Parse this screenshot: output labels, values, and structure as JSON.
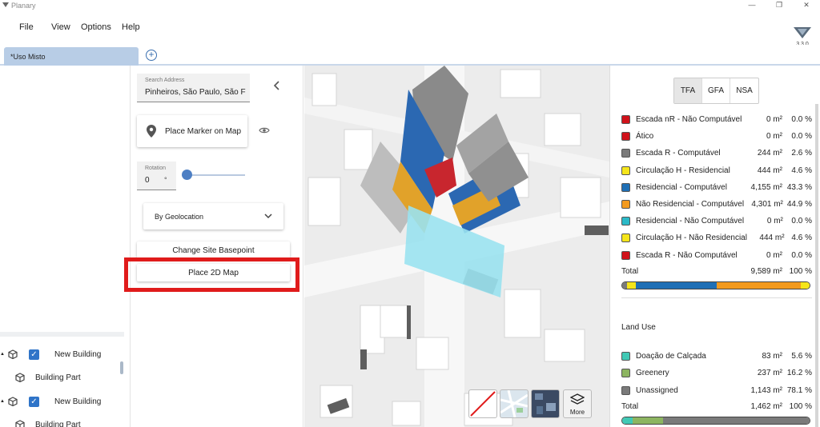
{
  "window": {
    "title": "Planary",
    "minimize": "—",
    "maximize": "❐",
    "close": "✕"
  },
  "menu": [
    "File",
    "View",
    "Options",
    "Help"
  ],
  "version": "3.3.0",
  "tabs": [
    {
      "label": "*Uso Misto"
    }
  ],
  "tree": [
    {
      "label": "New Building"
    },
    {
      "label": "Building Part"
    },
    {
      "label": "New Building"
    },
    {
      "label": "Building Part"
    }
  ],
  "site": {
    "search_label": "Search Address",
    "search_value": "Pinheiros, São Paulo, São F",
    "place_marker": "Place Marker on Map",
    "rotation_label": "Rotation",
    "rotation_value": "0",
    "rotation_unit": "°",
    "geolocation": "By Geolocation",
    "change_basepoint": "Change Site Basepoint",
    "place_2d_map": "Place 2D Map"
  },
  "map_controls": {
    "more": "More"
  },
  "area_tabs": {
    "items": [
      "TFA",
      "GFA",
      "NSA"
    ],
    "active": "TFA"
  },
  "area_rows": [
    {
      "label": "Escada nR - Não Computável",
      "area": "0 m²",
      "pct": "0.0 %",
      "color": "#d0121b"
    },
    {
      "label": "Ático",
      "area": "0 m²",
      "pct": "0.0 %",
      "color": "#d0121b"
    },
    {
      "label": "Escada R - Computável",
      "area": "244 m²",
      "pct": "2.6 %",
      "color": "#7a7a7a"
    },
    {
      "label": "Circulação H - Residencial",
      "area": "444 m²",
      "pct": "4.6 %",
      "color": "#f5e51a"
    },
    {
      "label": "Residencial - Computável",
      "area": "4,155 m²",
      "pct": "43.3 %",
      "color": "#1f6fb5"
    },
    {
      "label": "Não Residencial - Computável",
      "area": "4,301 m²",
      "pct": "44.9 %",
      "color": "#f39a1e"
    },
    {
      "label": "Residencial - Não Computável",
      "area": "0 m²",
      "pct": "0.0 %",
      "color": "#2bb9c7"
    },
    {
      "label": "Circulação H - Não Residencial",
      "area": "444 m²",
      "pct": "4.6 %",
      "color": "#f5e51a"
    },
    {
      "label": "Escada R - Não Computável",
      "area": "0 m²",
      "pct": "0.0 %",
      "color": "#d0121b"
    }
  ],
  "area_total": {
    "label": "Total",
    "area": "9,589 m²",
    "pct": "100 %"
  },
  "land_use_title": "Land Use",
  "land_rows": [
    {
      "label": "Doação de Calçada",
      "area": "83 m²",
      "pct": "5.6 %",
      "color": "#41c9b5"
    },
    {
      "label": "Greenery",
      "area": "237 m²",
      "pct": "16.2 %",
      "color": "#8db561"
    },
    {
      "label": "Unassigned",
      "area": "1,143 m²",
      "pct": "78.1 %",
      "color": "#7a7a7a"
    }
  ],
  "land_total": {
    "label": "Total",
    "area": "1,462 m²",
    "pct": "100 %"
  }
}
